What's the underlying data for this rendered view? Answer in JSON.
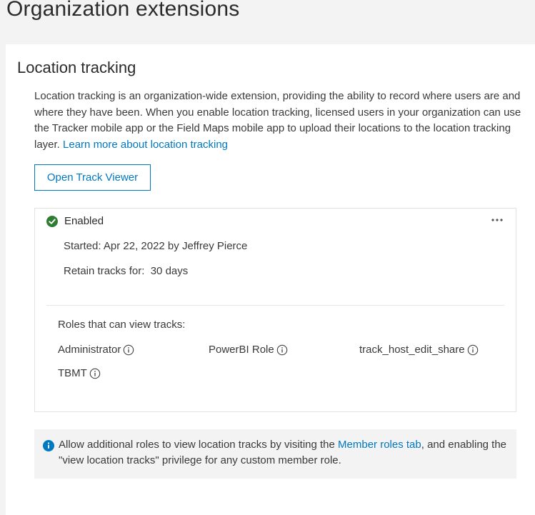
{
  "page": {
    "title": "Organization extensions"
  },
  "section": {
    "title": "Location tracking",
    "description": "Location tracking is an organization-wide extension, providing the ability to record where users are and where they have been. When you enable location tracking, licensed users in your organization can use the Tracker mobile app or the Field Maps mobile app to upload their locations to the location tracking layer.",
    "learn_more_link": "Learn more about location tracking",
    "open_button": "Open Track Viewer"
  },
  "status": {
    "label": "Enabled",
    "started": "Started: Apr 22, 2022 by Jeffrey Pierce",
    "retain_label": "Retain tracks for:",
    "retain_value": "30 days",
    "roles_label": "Roles that can view tracks:",
    "roles": [
      "Administrator",
      "PowerBI Role",
      "track_host_edit_share",
      "TBMT"
    ]
  },
  "notice": {
    "text_before": "Allow additional roles to view location tracks by visiting the",
    "link": "Member roles tab",
    "text_after": ", and enabling the \"view location tracks\" privilege for any custom member role."
  },
  "colors": {
    "accent": "#0079c1",
    "success": "#35ac46",
    "background": "#f3f3f3"
  },
  "icons": {
    "status": "check-circle-icon",
    "menu": "more-horizontal-icon",
    "info": "info-circle-icon"
  }
}
